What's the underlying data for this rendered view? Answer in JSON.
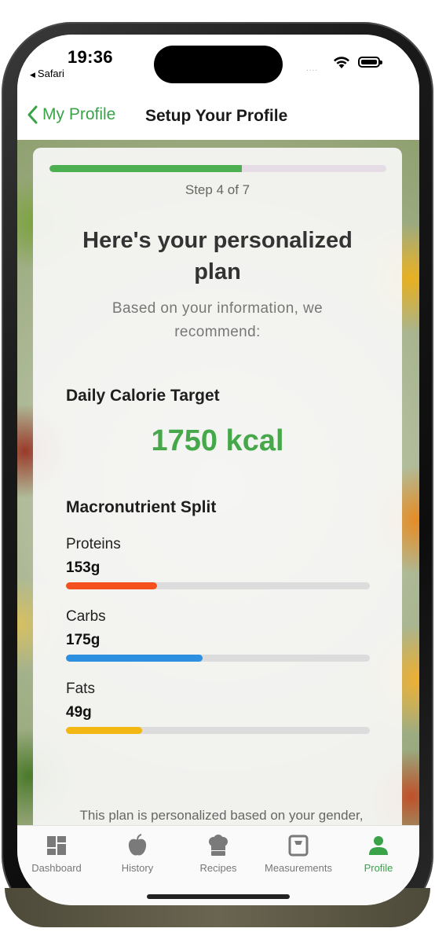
{
  "status": {
    "time": "19:36",
    "back_app": "Safari",
    "signal": "...."
  },
  "nav": {
    "back_label": "My Profile",
    "title": "Setup Your Profile"
  },
  "progress": {
    "step_text": "Step 4 of 7",
    "fraction": 0.57
  },
  "plan": {
    "heading": "Here's your personalized plan",
    "subheading": "Based on your information, we recommend:",
    "calorie_title": "Daily Calorie Target",
    "calorie_value": "1750 kcal",
    "macro_title": "Macronutrient Split",
    "macros": [
      {
        "label": "Proteins",
        "value": "153g",
        "fraction": 0.3,
        "color": "#f4511e"
      },
      {
        "label": "Carbs",
        "value": "175g",
        "fraction": 0.45,
        "color": "#2c8fe0"
      },
      {
        "label": "Fats",
        "value": "49g",
        "fraction": 0.25,
        "color": "#f2b712"
      }
    ],
    "note": "This plan is personalized based on your gender,"
  },
  "tabs": [
    {
      "label": "Dashboard",
      "icon": "dashboard-icon"
    },
    {
      "label": "History",
      "icon": "apple-icon"
    },
    {
      "label": "Recipes",
      "icon": "chef-hat-icon"
    },
    {
      "label": "Measurements",
      "icon": "scale-icon"
    },
    {
      "label": "Profile",
      "icon": "person-icon",
      "active": true
    }
  ],
  "colors": {
    "accent": "#3aa34a",
    "calorie": "#46a84a",
    "progress": "#4caf50"
  }
}
